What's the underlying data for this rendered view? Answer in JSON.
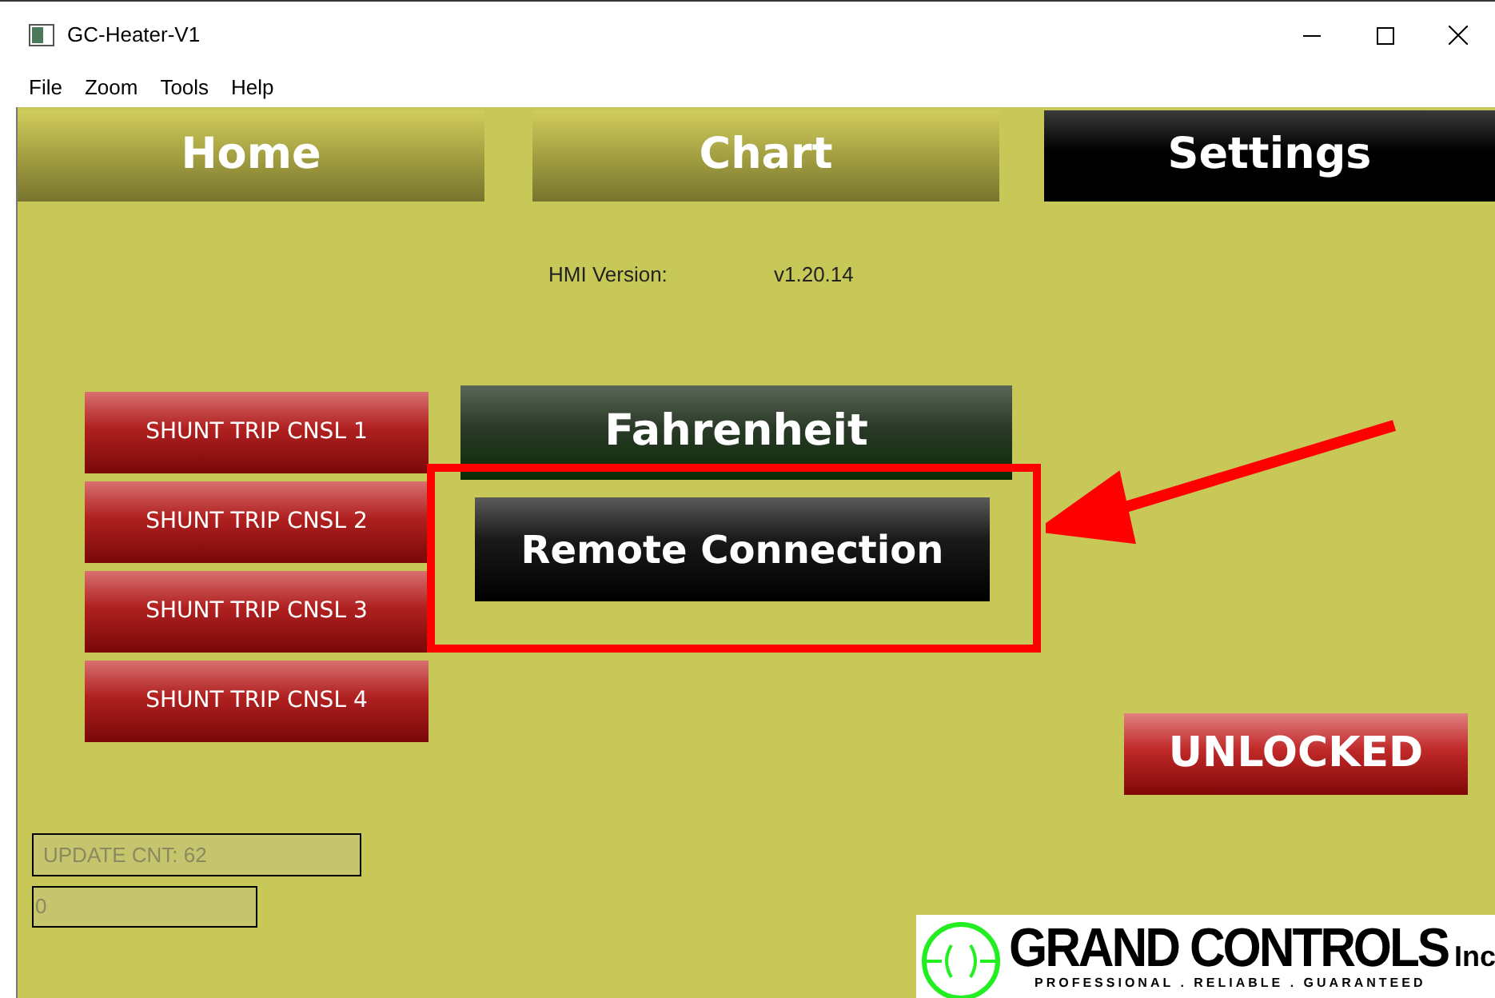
{
  "window": {
    "title": "GC-Heater-V1"
  },
  "menu": [
    "File",
    "Zoom",
    "Tools",
    "Help"
  ],
  "tabs": [
    {
      "label": "Home",
      "selected": false
    },
    {
      "label": "Chart",
      "selected": false
    },
    {
      "label": "Settings",
      "selected": true
    }
  ],
  "version": {
    "label": "HMI Version:",
    "value": "v1.20.14"
  },
  "shunt_buttons": [
    "SHUNT TRIP CNSL 1",
    "SHUNT TRIP CNSL 2",
    "SHUNT TRIP CNSL 3",
    "SHUNT TRIP CNSL 4"
  ],
  "unit_button": "Fahrenheit",
  "remote_button": "Remote Connection",
  "lock_button": "UNLOCKED",
  "fields": [
    "UPDATE CNT: 62",
    "0"
  ],
  "logo": {
    "name": "GRAND CONTROLS",
    "suffix": "Inc",
    "tagline": "PROFESSIONAL . RELIABLE . GUARANTEED"
  }
}
